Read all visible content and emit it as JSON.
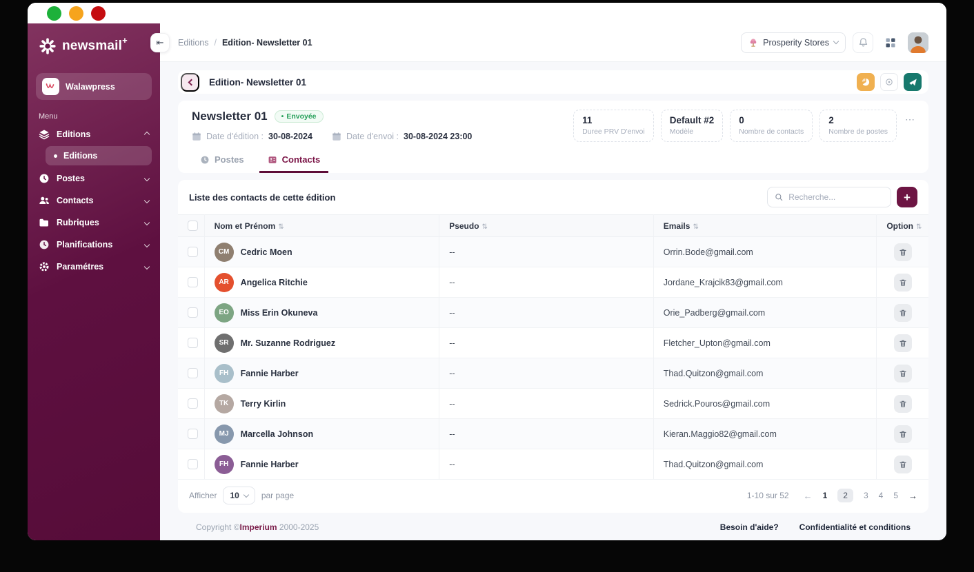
{
  "colors": {
    "sidebar_dark": "#570c39",
    "sidebar_light": "#82335f",
    "accent_maroon": "#6d1543",
    "tab_active": "#7a1446",
    "teal_action": "#17796d",
    "orange_action": "#f0b050",
    "badge_green": "#27a05a",
    "traffic": [
      "#1db13a",
      "#f6a41d",
      "#c50d10"
    ]
  },
  "icons": {
    "sort": "⇅",
    "collapse": "⇤",
    "prev_arrow": "←",
    "next_arrow": "→",
    "more": "⋯",
    "dot": "•"
  },
  "sidebar": {
    "logo": {
      "text": "newsmail",
      "plus": "+"
    },
    "workspace": {
      "label": "Walawpress"
    },
    "menu_label": "Menu",
    "items": [
      {
        "label": "Editions"
      },
      {
        "label": "Postes"
      },
      {
        "label": "Contacts"
      },
      {
        "label": "Rubriques"
      },
      {
        "label": "Planifications"
      },
      {
        "label": "Paramétres"
      }
    ],
    "subitem": {
      "label": "Editions"
    }
  },
  "topbar": {
    "breadcrumb_parent": "Editions",
    "breadcrumb_sep": "/",
    "breadcrumb_current": "Edition- Newsletter 01",
    "org": {
      "label": "Prosperity Stores"
    }
  },
  "page_header": {
    "title": "Edition- Newsletter 01"
  },
  "newsletter": {
    "title": "Newsletter 01",
    "status": "Envoyée",
    "edition_date_label": "Date d'édition :",
    "edition_date": "30-08-2024",
    "send_date_label": "Date d'envoi :",
    "send_date": "30-08-2024 23:00",
    "stats": [
      {
        "value": "11",
        "label": "Duree PRV D'envoi"
      },
      {
        "value": "Default #2",
        "label": "Modèle"
      },
      {
        "value": "0",
        "label": "Nombre de contacts"
      },
      {
        "value": "2",
        "label": "Nombre de postes"
      }
    ],
    "tabs": [
      {
        "label": "Postes"
      },
      {
        "label": "Contacts"
      }
    ]
  },
  "contacts": {
    "title": "Liste des contacts de cette édition",
    "search_placeholder": "Recherche...",
    "add_label": "+",
    "columns": [
      "Nom et Prénom",
      "Pseudo",
      "Emails",
      "Option"
    ],
    "rows": [
      {
        "name": "Cedric Moen",
        "pseudo": "--",
        "email": "Orrin.Bode@gmail.com",
        "initials": "CM",
        "avatar_color": "#8f7f70"
      },
      {
        "name": "Angelica Ritchie",
        "pseudo": "--",
        "email": "Jordane_Krajcik83@gmail.com",
        "initials": "AR",
        "avatar_color": "#e4502e"
      },
      {
        "name": "Miss Erin Okuneva",
        "pseudo": "--",
        "email": "Orie_Padberg@gmail.com",
        "initials": "EO",
        "avatar_color": "#7da583"
      },
      {
        "name": "Mr. Suzanne Rodriguez",
        "pseudo": "--",
        "email": "Fletcher_Upton@gmail.com",
        "initials": "SR",
        "avatar_color": "#6f6f6f"
      },
      {
        "name": "Fannie Harber",
        "pseudo": "--",
        "email": "Thad.Quitzon@gmail.com",
        "initials": "FH",
        "avatar_color": "#a9bfca"
      },
      {
        "name": "Terry Kirlin",
        "pseudo": "--",
        "email": "Sedrick.Pouros@gmail.com",
        "initials": "TK",
        "avatar_color": "#b5a8a2"
      },
      {
        "name": "Marcella Johnson",
        "pseudo": "--",
        "email": "Kieran.Maggio82@gmail.com",
        "initials": "MJ",
        "avatar_color": "#8798ad"
      },
      {
        "name": "Fannie Harber",
        "pseudo": "--",
        "email": "Thad.Quitzon@gmail.com",
        "initials": "FH",
        "avatar_color": "#8b5d95"
      }
    ],
    "pagination": {
      "show_label": "Afficher",
      "per_page": "10",
      "per_page_suffix": "par page",
      "range": "1-10 sur 52",
      "pages": [
        "1",
        "2",
        "3",
        "4",
        "5"
      ],
      "current_page": "2"
    }
  },
  "footer": {
    "copyright_prefix": "Copyright ©",
    "copyright_brand": "Imperium",
    "copyright_suffix": " 2000-2025",
    "help": "Besoin d'aide?",
    "privacy": "Confidentialité et conditions"
  }
}
